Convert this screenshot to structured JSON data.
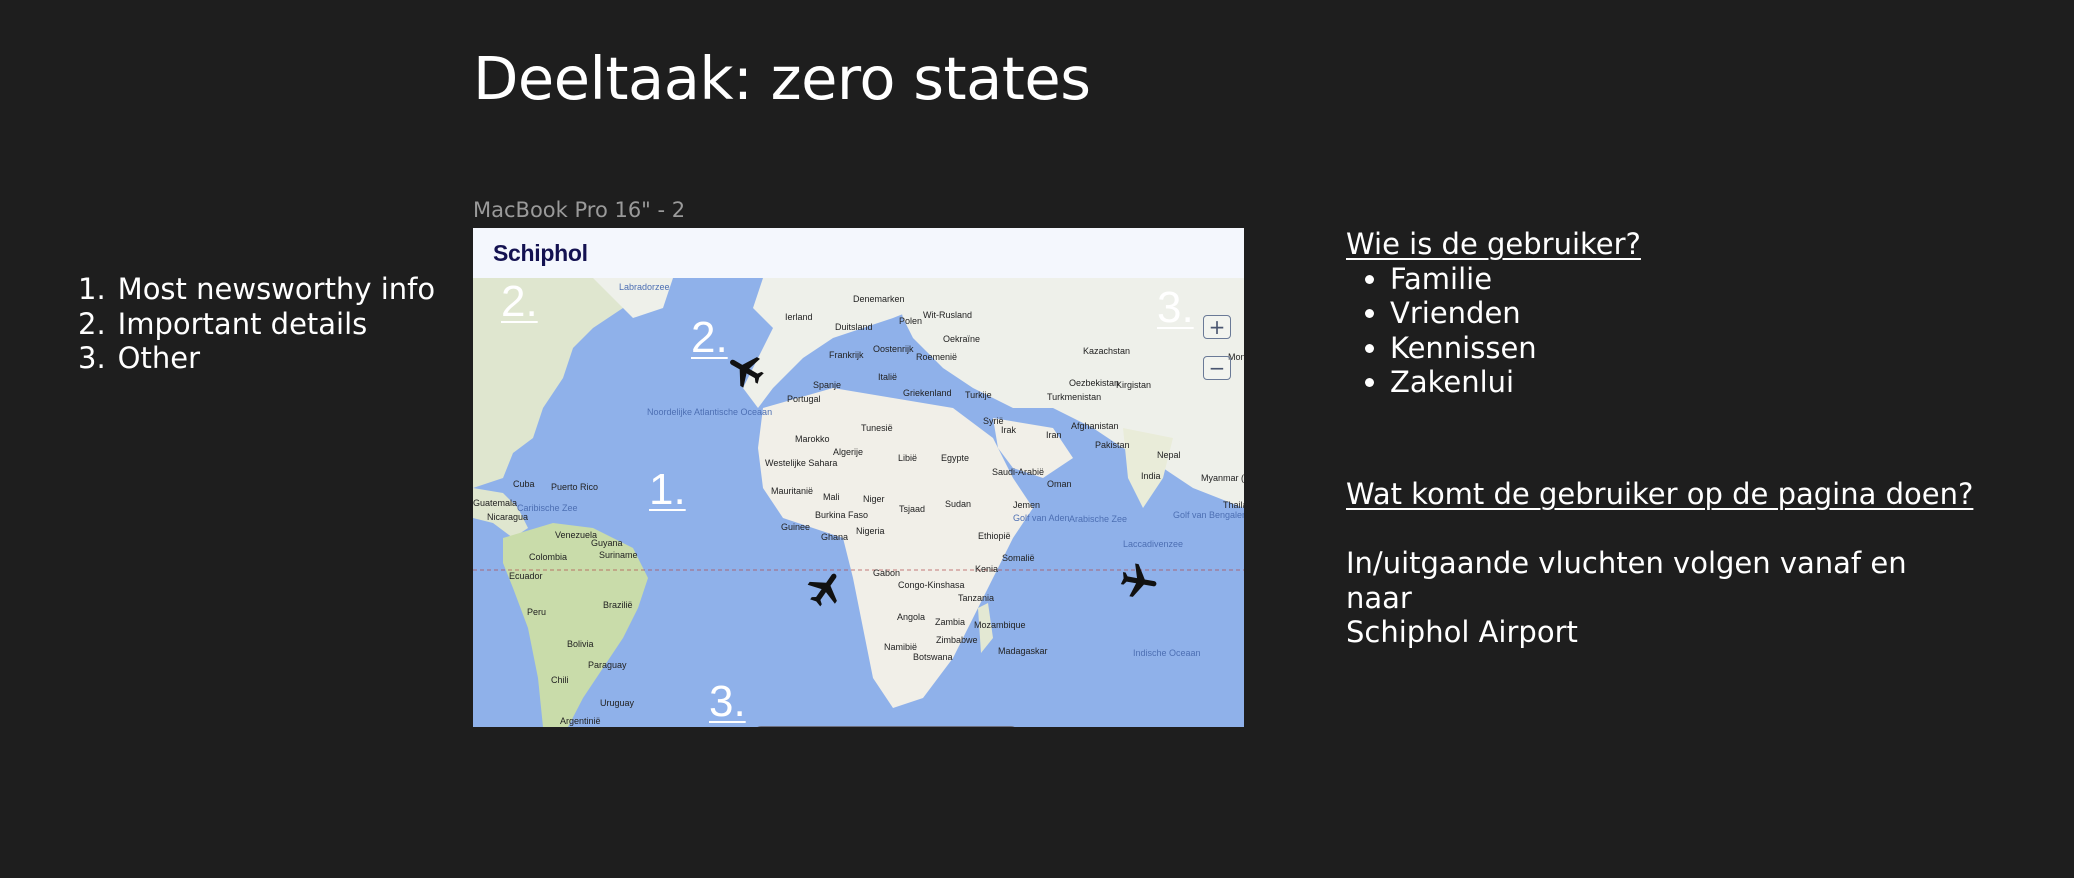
{
  "page": {
    "title": "Deeltaak: zero states"
  },
  "priority_list": [
    {
      "number": "1.",
      "label": "Most newsworthy info"
    },
    {
      "number": "2.",
      "label": "Important details"
    },
    {
      "number": "3.",
      "label": "Other"
    }
  ],
  "frame": {
    "label": "MacBook Pro 16\" - 2",
    "brand": "Schiphol",
    "markers": [
      "2.",
      "2.",
      "3.",
      "1.",
      "3."
    ],
    "countries": [
      "Denemarken",
      "Ierland",
      "Duitsland",
      "Polen",
      "Wit-Rusland",
      "Frankrijk",
      "Oostenrijk",
      "Oekraïne",
      "Roemenië",
      "Spanje",
      "Italië",
      "Griekenland",
      "Turkije",
      "Portugal",
      "Tunesië",
      "Kazachstan",
      "Oezbekistan",
      "Kirgistan",
      "Turkmenistan",
      "Syrië",
      "Irak",
      "Iran",
      "Afghanistan",
      "Marokko",
      "Algerije",
      "Libië",
      "Egypte",
      "Pakistan",
      "Nepal",
      "Westelijke Sahara",
      "Saudi-Arabië",
      "Oman",
      "India",
      "Myanmar (Birma)",
      "Mauritanië",
      "Mali",
      "Niger",
      "Tsjaad",
      "Sudan",
      "Jemen",
      "Burkina Faso",
      "Guinee",
      "Ghana",
      "Nigeria",
      "Ethiopië",
      "Somalië",
      "Cuba",
      "Puerto Rico",
      "Guatemala",
      "Nicaragua",
      "Venezuela",
      "Guyana",
      "Suriname",
      "Colombia",
      "Ecuador",
      "Gabon",
      "Congo-Kinshasa",
      "Kenia",
      "Tanzania",
      "Peru",
      "Brazilië",
      "Angola",
      "Zambia",
      "Mozambique",
      "Bolivia",
      "Zimbabwe",
      "Namibië",
      "Botswana",
      "Madagaskar",
      "Paraguay",
      "Chili",
      "Uruguay",
      "Argentinië",
      "Thaila",
      "Mon"
    ],
    "oceans": [
      "Noordelijke Atlantische Oceaan",
      "Caribische Zee",
      "Golf van Aden",
      "Arabische Zee",
      "Laccadivenzee",
      "Golf van Bengalen",
      "Indische Oceaan",
      "Labradorzee"
    ],
    "toolbar": {
      "icons": [
        "gear-icon",
        "sliders-icon",
        "search-icon"
      ]
    },
    "zoom": {
      "in": "+",
      "out": "−"
    }
  },
  "right_panel": {
    "user_heading": "Wie is de gebruiker?",
    "users": [
      "Familie",
      "Vrienden",
      "Kennissen",
      "Zakenlui"
    ],
    "purpose_heading": "Wat komt de gebruiker op de pagina doen?",
    "purpose_line1": "In/uitgaande vluchten volgen vanaf en naar",
    "purpose_line2": "Schiphol Airport"
  },
  "colors": {
    "background": "#1e1e1e",
    "ocean": "#8fb1ea",
    "land": "#f1efe8",
    "brand": "#141251"
  }
}
